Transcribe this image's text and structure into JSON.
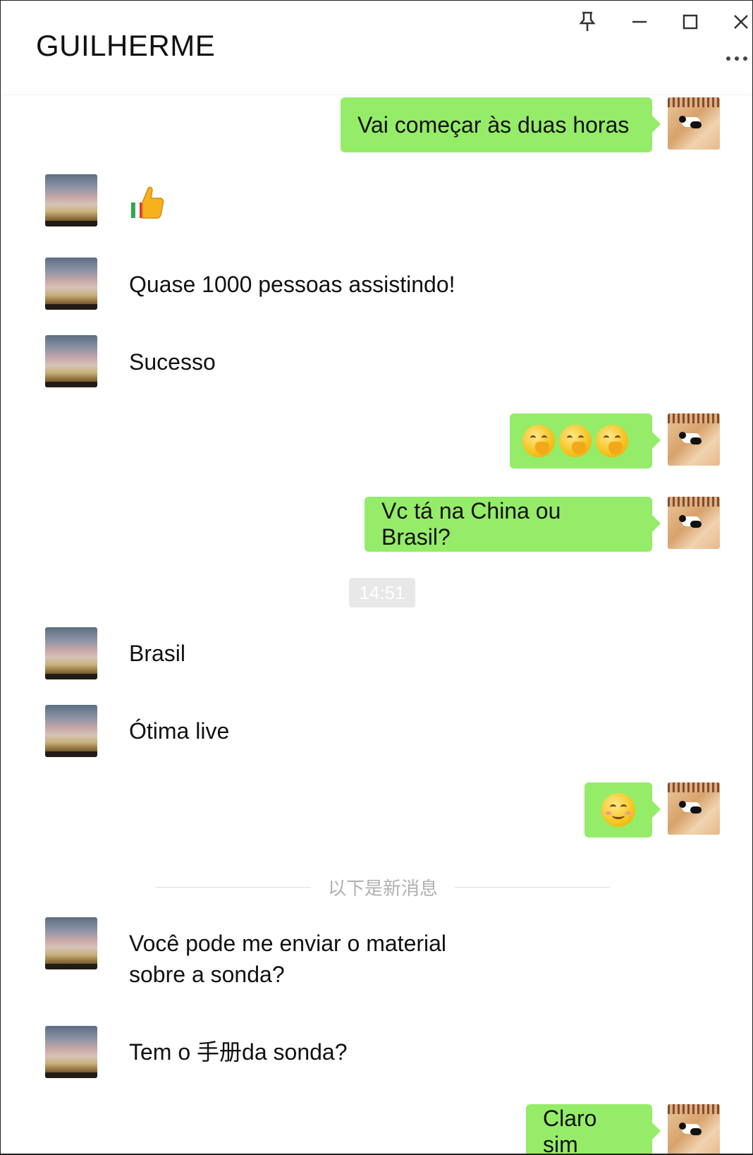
{
  "window": {
    "title": "GUILHERME",
    "controls": [
      "pin-icon",
      "minimize-icon",
      "maximize-icon",
      "close-icon"
    ],
    "more_menu": "more-icon"
  },
  "messages": [
    {
      "side": "out",
      "type": "text",
      "text": "Vai começar às duas horas"
    },
    {
      "side": "in",
      "type": "emoji",
      "emoji": "thumbs-up"
    },
    {
      "side": "in",
      "type": "text",
      "text": "Quase 1000 pessoas assistindo!"
    },
    {
      "side": "in",
      "type": "text",
      "text": "Sucesso"
    },
    {
      "side": "out",
      "type": "emoji",
      "emoji": "hand-over-mouth x3"
    },
    {
      "side": "out",
      "type": "text",
      "text": "Vc tá na China ou Brasil?"
    },
    {
      "side": "in",
      "type": "text",
      "text": "Brasil"
    },
    {
      "side": "in",
      "type": "text",
      "text": "Ótima live"
    },
    {
      "side": "out",
      "type": "emoji",
      "emoji": "smiling-face"
    },
    {
      "side": "in",
      "type": "text",
      "text_line1": "Você pode me enviar o material",
      "text_line2": "sobre a sonda?"
    },
    {
      "side": "in",
      "type": "text",
      "text": "Tem o 手册da sonda?"
    },
    {
      "side": "out",
      "type": "text",
      "text": "Claro sim"
    }
  ],
  "timestamp": "14:51",
  "new_messages_divider": "以下是新消息",
  "colors": {
    "outgoing_bubble": "#95ec69",
    "background": "#ffffff"
  }
}
